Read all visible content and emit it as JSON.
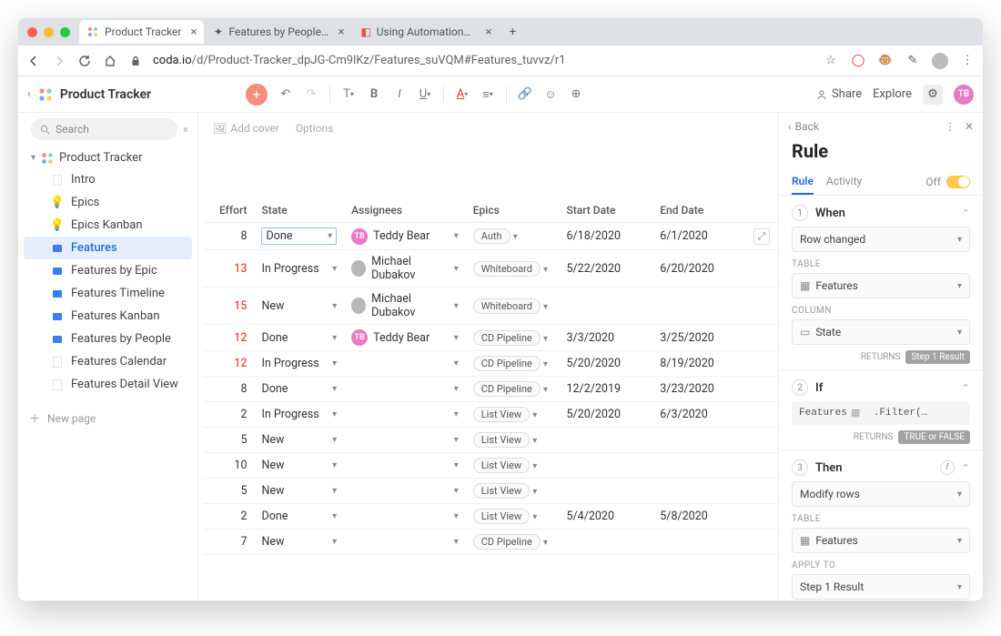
{
  "browser": {
    "tabs": [
      {
        "title": "Product Tracker",
        "active": true
      },
      {
        "title": "Features by People | Fibery",
        "active": false
      },
      {
        "title": "Using Automations | Coda Hel…",
        "active": false
      }
    ],
    "url_host": "coda.io",
    "url_path": "/d/Product-Tracker_dpJG-Cm9lKz/Features_suVQM#Features_tuvvz/r1"
  },
  "app": {
    "title": "Product Tracker",
    "share": "Share",
    "explore": "Explore",
    "avatar": "TB"
  },
  "sidebar": {
    "search_placeholder": "Search",
    "workspace": "Product Tracker",
    "items": [
      {
        "label": "Intro",
        "icon": "doc"
      },
      {
        "label": "Epics",
        "icon": "bulb"
      },
      {
        "label": "Epics Kanban",
        "icon": "bulb"
      },
      {
        "label": "Features",
        "icon": "bluefolder",
        "active": true
      },
      {
        "label": "Features by Epic",
        "icon": "bluefolder"
      },
      {
        "label": "Features Timeline",
        "icon": "bluefolder"
      },
      {
        "label": "Features Kanban",
        "icon": "bluefolder"
      },
      {
        "label": "Features by People",
        "icon": "bluefolder"
      },
      {
        "label": "Features Calendar",
        "icon": "doc"
      },
      {
        "label": "Features Detail View",
        "icon": "doc"
      }
    ],
    "new_page": "New page"
  },
  "cover": {
    "add_cover": "Add cover",
    "options": "Options"
  },
  "table": {
    "headers": {
      "effort": "Effort",
      "state": "State",
      "assignees": "Assignees",
      "epics": "Epics",
      "start": "Start Date",
      "end": "End Date"
    },
    "rows": [
      {
        "effort": "8",
        "effort_red": false,
        "state": "Done",
        "state_boxed": true,
        "assignee": "Teddy Bear",
        "av": "tb",
        "epic": "Auth",
        "start": "6/18/2020",
        "end": "6/1/2020",
        "expand": true
      },
      {
        "effort": "13",
        "effort_red": true,
        "state": "In Progress",
        "assignee": "Michael Dubakov",
        "av": "md",
        "epic": "Whiteboard",
        "start": "5/22/2020",
        "end": "6/20/2020"
      },
      {
        "effort": "15",
        "effort_red": true,
        "state": "New",
        "assignee": "Michael Dubakov",
        "av": "md",
        "epic": "Whiteboard",
        "start": "",
        "end": ""
      },
      {
        "effort": "12",
        "effort_red": true,
        "state": "Done",
        "assignee": "Teddy Bear",
        "av": "tb",
        "epic": "CD Pipeline",
        "start": "3/3/2020",
        "end": "3/25/2020"
      },
      {
        "effort": "12",
        "effort_red": true,
        "state": "In Progress",
        "assignee": "",
        "av": "",
        "epic": "CD Pipeline",
        "start": "5/20/2020",
        "end": "8/19/2020"
      },
      {
        "effort": "8",
        "effort_red": false,
        "state": "Done",
        "assignee": "",
        "av": "",
        "epic": "CD Pipeline",
        "start": "12/2/2019",
        "end": "3/23/2020"
      },
      {
        "effort": "2",
        "effort_red": false,
        "state": "In Progress",
        "assignee": "",
        "av": "",
        "epic": "List View",
        "start": "5/20/2020",
        "end": "6/3/2020"
      },
      {
        "effort": "5",
        "effort_red": false,
        "state": "New",
        "assignee": "",
        "av": "",
        "epic": "List View",
        "start": "",
        "end": ""
      },
      {
        "effort": "10",
        "effort_red": false,
        "state": "New",
        "assignee": "",
        "av": "",
        "epic": "List View",
        "start": "",
        "end": ""
      },
      {
        "effort": "5",
        "effort_red": false,
        "state": "New",
        "assignee": "",
        "av": "",
        "epic": "List View",
        "start": "",
        "end": ""
      },
      {
        "effort": "2",
        "effort_red": false,
        "state": "Done",
        "assignee": "",
        "av": "",
        "epic": "List View",
        "start": "5/4/2020",
        "end": "5/8/2020"
      },
      {
        "effort": "7",
        "effort_red": false,
        "state": "New",
        "assignee": "",
        "av": "",
        "epic": "CD Pipeline",
        "start": "",
        "end": ""
      }
    ]
  },
  "panel": {
    "back": "Back",
    "title": "Rule",
    "tab_rule": "Rule",
    "tab_activity": "Activity",
    "toggle_label": "Off",
    "when": {
      "title": "When",
      "trigger": "Row changed",
      "table_label": "TABLE",
      "table_value": "Features",
      "column_label": "COLUMN",
      "column_value": "State",
      "returns_label": "RETURNS",
      "returns_value": "Step 1 Result"
    },
    "if": {
      "title": "If",
      "code_pre": "Features",
      "code_post": ".Filter(…",
      "returns_label": "RETURNS",
      "returns_value": "TRUE or FALSE"
    },
    "then": {
      "title": "Then",
      "action": "Modify rows",
      "table_label": "TABLE",
      "table_value": "Features",
      "apply_label": "APPLY TO",
      "apply_value": "Step 1 Result"
    }
  }
}
